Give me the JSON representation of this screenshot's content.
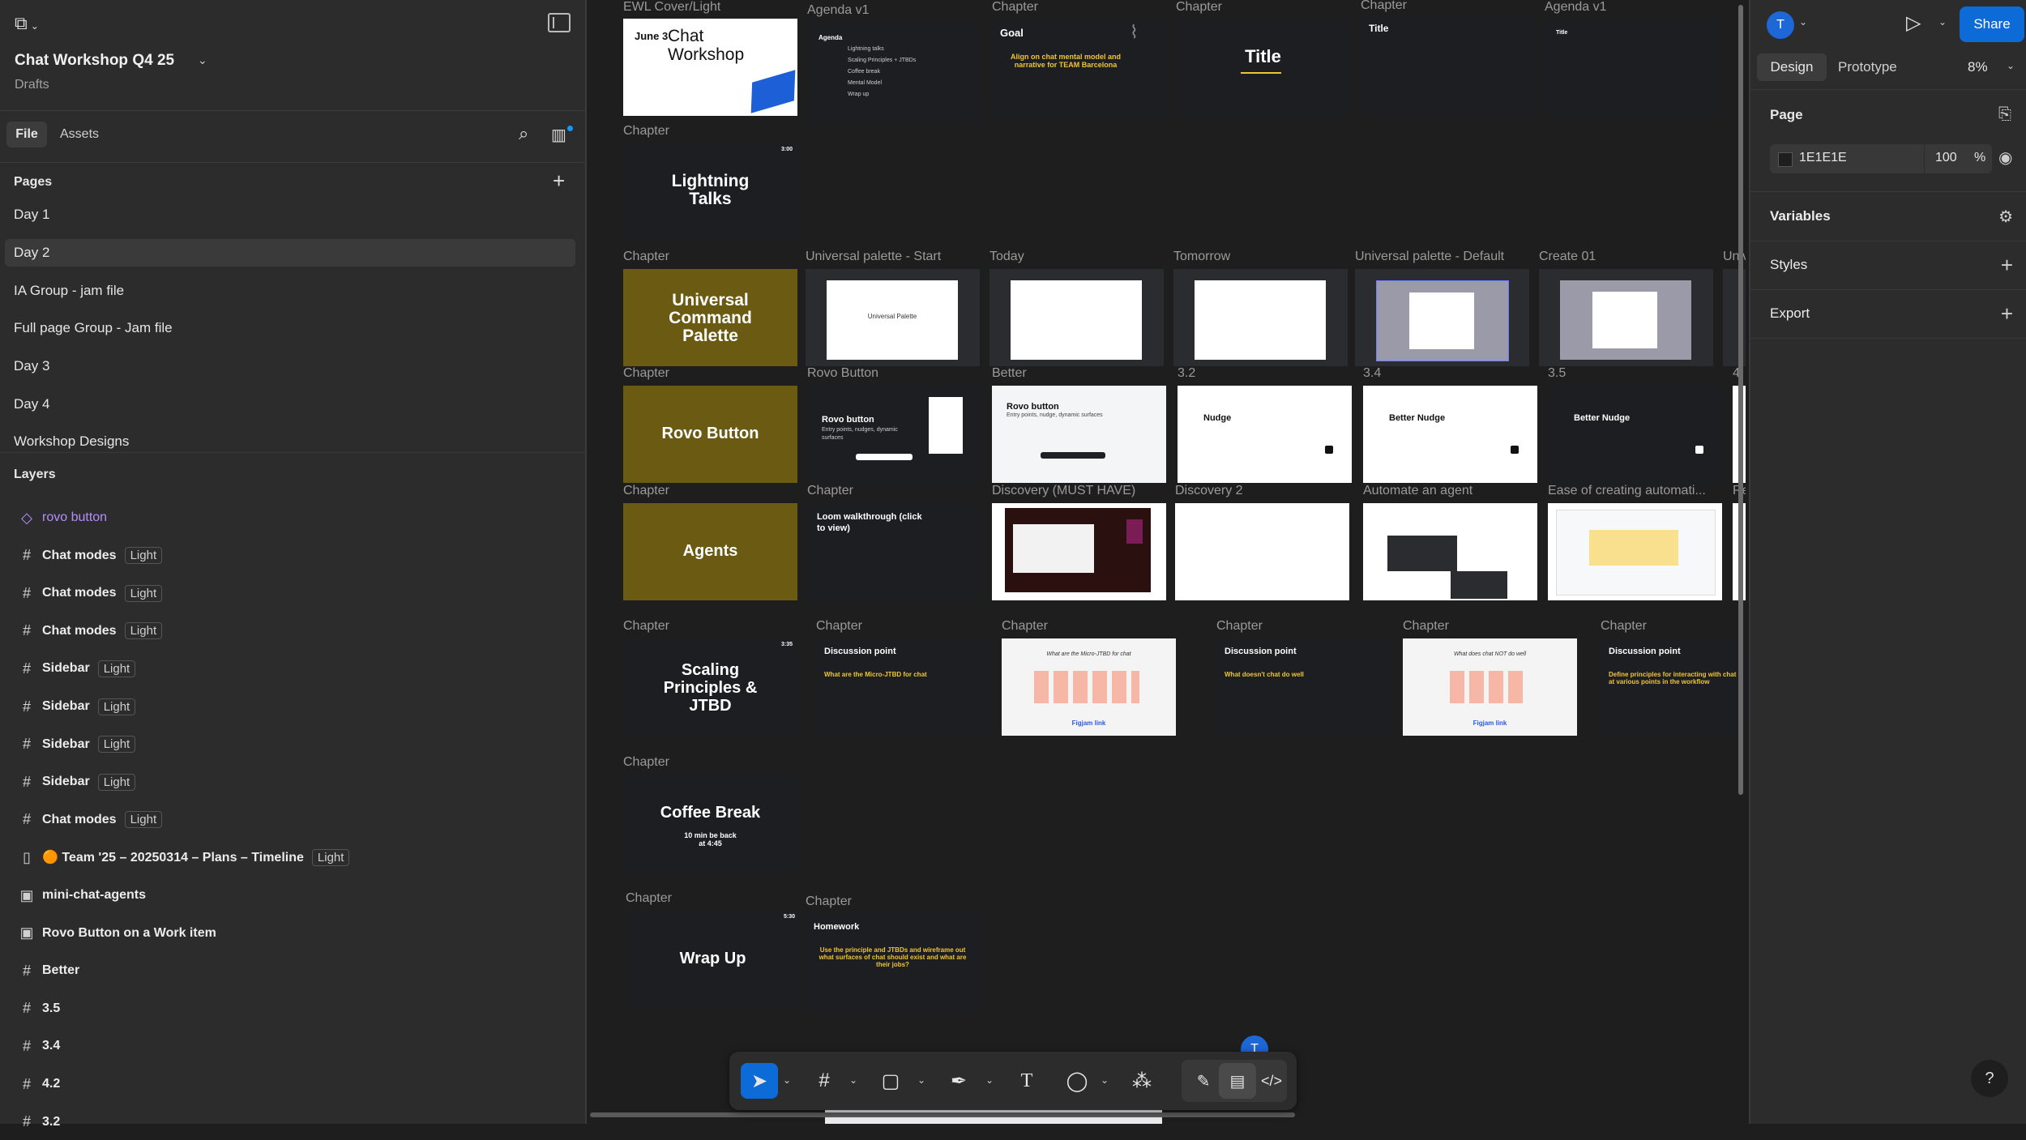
{
  "app": {
    "file_title": "Chat Workshop Q4 25",
    "file_location": "Drafts"
  },
  "left_tabs": {
    "file": "File",
    "assets": "Assets"
  },
  "pages": {
    "header": "Pages",
    "items": [
      "Day 1",
      "Day 2",
      "IA Group  - jam file",
      "Full page Group - Jam file",
      "Day 3",
      "Day 4",
      "Workshop Designs"
    ]
  },
  "layers": {
    "header": "Layers",
    "items": [
      {
        "icon": "component-icon",
        "name": "rovo button",
        "badge": ""
      },
      {
        "icon": "frame-icon",
        "name": "Chat modes",
        "badge": "Light"
      },
      {
        "icon": "frame-icon",
        "name": "Chat modes",
        "badge": "Light"
      },
      {
        "icon": "frame-icon",
        "name": "Chat modes",
        "badge": "Light"
      },
      {
        "icon": "frame-icon",
        "name": "Sidebar",
        "badge": "Light"
      },
      {
        "icon": "frame-icon",
        "name": "Sidebar",
        "badge": "Light"
      },
      {
        "icon": "frame-icon",
        "name": "Sidebar",
        "badge": "Light"
      },
      {
        "icon": "frame-icon",
        "name": "Sidebar",
        "badge": "Light"
      },
      {
        "icon": "frame-icon",
        "name": "Chat modes",
        "badge": "Light"
      },
      {
        "icon": "timeline-icon",
        "name": "🟠 Team '25 – 20250314 – Plans – Timeline",
        "badge": "Light"
      },
      {
        "icon": "section-icon",
        "name": "mini-chat-agents",
        "badge": ""
      },
      {
        "icon": "section-icon",
        "name": "Rovo Button on a Work item",
        "badge": ""
      },
      {
        "icon": "frame-icon",
        "name": "Better",
        "badge": ""
      },
      {
        "icon": "frame-icon",
        "name": "3.5",
        "badge": ""
      },
      {
        "icon": "frame-icon",
        "name": "3.4",
        "badge": ""
      },
      {
        "icon": "frame-icon",
        "name": "4.2",
        "badge": ""
      },
      {
        "icon": "frame-icon",
        "name": "3.2",
        "badge": ""
      }
    ]
  },
  "canvas": {
    "labels": {
      "r1": [
        "EWL Cover/Light",
        "Agenda v1",
        "Chapter",
        "Chapter",
        "Chapter",
        "Agenda v1"
      ],
      "r2": [
        "Chapter"
      ],
      "r3": [
        "Chapter",
        "Universal palette - Start",
        "Today",
        "Tomorrow",
        "Universal palette - Default",
        "Create 01",
        "Univ"
      ],
      "r4": [
        "Chapter",
        "Rovo Button",
        "Better",
        "3.2",
        "3.4",
        "3.5",
        "4"
      ],
      "r5": [
        "Chapter",
        "Chapter",
        "Discovery (MUST HAVE)",
        "Discovery 2",
        "Automate an agent",
        "Ease of creating automati...",
        "Re"
      ],
      "r6": [
        "Chapter",
        "Chapter",
        "Chapter",
        "Chapter",
        "Chapter",
        "Chapter"
      ],
      "r7": [
        "Chapter"
      ],
      "r8": [
        "Chapter",
        "Chapter"
      ]
    },
    "slides": {
      "cover_date": "June 3",
      "cover_title": "Chat Workshop",
      "agenda_title": "Agenda",
      "agenda_items": [
        "Lightning talks",
        "Scaling Principles + JTBDs",
        "Coffee break",
        "Mental Model",
        "Wrap up"
      ],
      "goal_title": "Goal",
      "goal_text": "Align on chat mental model and narrative for TEAM Barcelona",
      "title_slide": "Title",
      "title_small": "Title",
      "agenda_small": "Title",
      "lightning": "Lightning Talks",
      "lightning_time": "3:00",
      "ucp": "Universal Command Palette",
      "rovo_button": "Rovo Button",
      "rovo_button_card_title": "Rovo button",
      "rovo_button_card_sub": "Entry points, nudges, dynamic surfaces",
      "better_title": "Rovo button",
      "better_sub": "Entry points, nudge, dynamic surfaces",
      "nudge": "Nudge",
      "better_nudge": "Better Nudge",
      "better_nudge_dark": "Better Nudge",
      "agents": "Agents",
      "loom": "Loom walkthrough (click to view)",
      "scaling": "Scaling Principles & JTBD",
      "scaling_time": "3:35",
      "discussion": "Discussion point",
      "disc1_q": "What are the Micro-JTBD for chat",
      "disc2_q": "What doesn't chat do well",
      "disc3_q": "Define principles for interacting with chat at various points in the workflow",
      "figjam_q1": "What are the Micro-JTBD for chat",
      "figjam_q2": "What does chat NOT do well",
      "figjam_link": "Figjam link",
      "coffee": "Coffee Break",
      "coffee_sub": "10 min be back at 4:45",
      "wrap": "Wrap Up",
      "wrap_time": "5:30",
      "homework": "Homework",
      "homework_text": "Use the principle and JTBDs and wireframe out what surfaces of chat should exist and what are their jobs?",
      "universal_palette": "Universal Palette"
    }
  },
  "toolbar": {
    "tools": [
      "move-tool",
      "frame-tool",
      "shape-tool",
      "pen-tool",
      "text-tool",
      "comment-tool",
      "actions-tool",
      "draw-mode",
      "design-mode",
      "dev-mode"
    ]
  },
  "right_panel": {
    "avatar_initial": "T",
    "share_label": "Share",
    "tabs": [
      "Design",
      "Prototype"
    ],
    "zoom": "8%",
    "page_section": "Page",
    "page_color": "1E1E1E",
    "page_opacity": "100",
    "percent": "%",
    "variables": "Variables",
    "styles": "Styles",
    "export": "Export",
    "help": "?"
  },
  "cursor_avatar": "T",
  "colors": {
    "accent": "#0d6bd8",
    "panel": "#2c2c2c",
    "canvas": "#1e1e1e",
    "gold": "#6b5a12",
    "yellow": "#f0c630"
  }
}
